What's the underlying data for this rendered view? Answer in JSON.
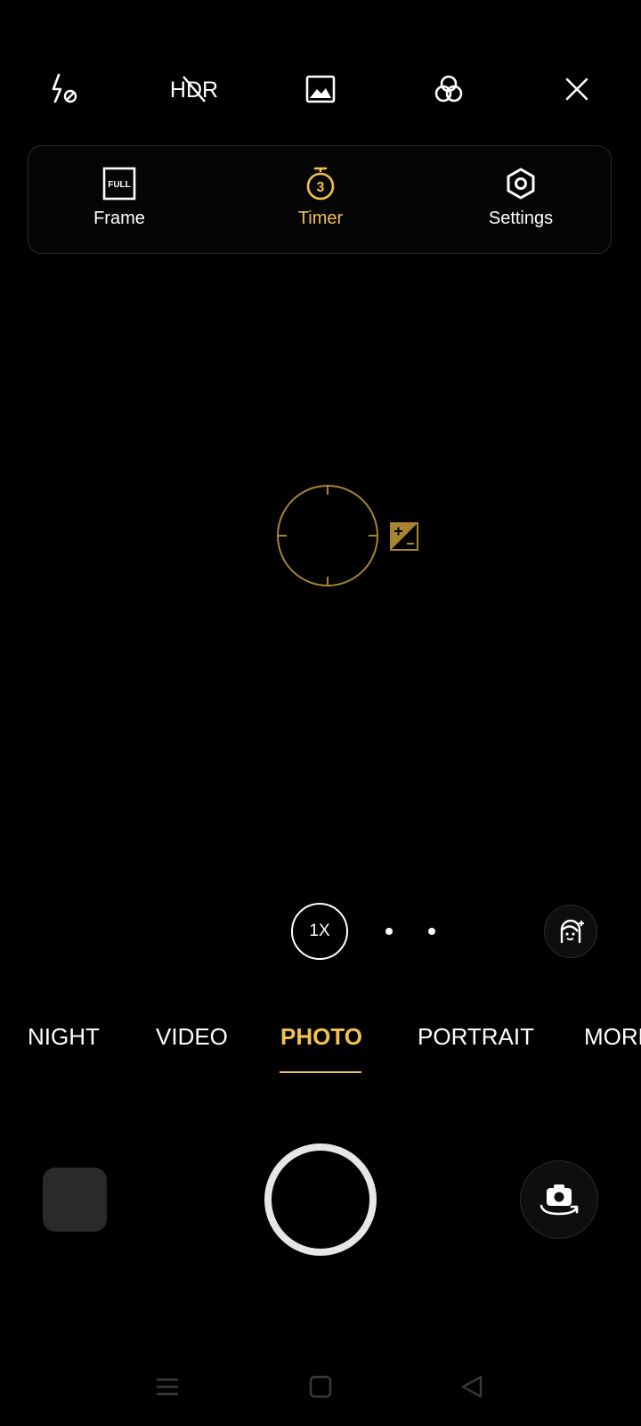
{
  "colors": {
    "accent": "#f2c14e",
    "reticle": "#a88432",
    "background": "#000000",
    "panel_border": "#2a2a2a"
  },
  "top_bar": {
    "flash_icon": "flash-off-icon",
    "hdr_label": "HDR",
    "hdr_icon": "hdr-off-icon",
    "image_icon": "image-icon",
    "filters_icon": "filters-icon",
    "close_icon": "close-icon"
  },
  "quick_panel": {
    "items": [
      {
        "label": "Frame",
        "icon": "frame-full-icon",
        "icon_text": "FULL",
        "active": false
      },
      {
        "label": "Timer",
        "icon": "timer-3s-icon",
        "icon_text": "3",
        "active": true
      },
      {
        "label": "Settings",
        "icon": "settings-icon",
        "active": false
      }
    ]
  },
  "viewfinder": {
    "reticle_icon": "focus-reticle-icon",
    "exposure_icon": "exposure-icon"
  },
  "zoom": {
    "current_label": "1X",
    "dots": 2,
    "beauty_icon": "beauty-face-icon"
  },
  "modes": {
    "items": [
      "NIGHT",
      "VIDEO",
      "PHOTO",
      "PORTRAIT",
      "MORE"
    ],
    "active": "PHOTO"
  },
  "bottom": {
    "gallery_icon": "gallery-thumbnail",
    "shutter_icon": "shutter-button",
    "flip_icon": "flip-camera-icon"
  },
  "nav": {
    "menu_icon": "menu-icon",
    "home_icon": "home-icon",
    "back_icon": "back-icon"
  }
}
